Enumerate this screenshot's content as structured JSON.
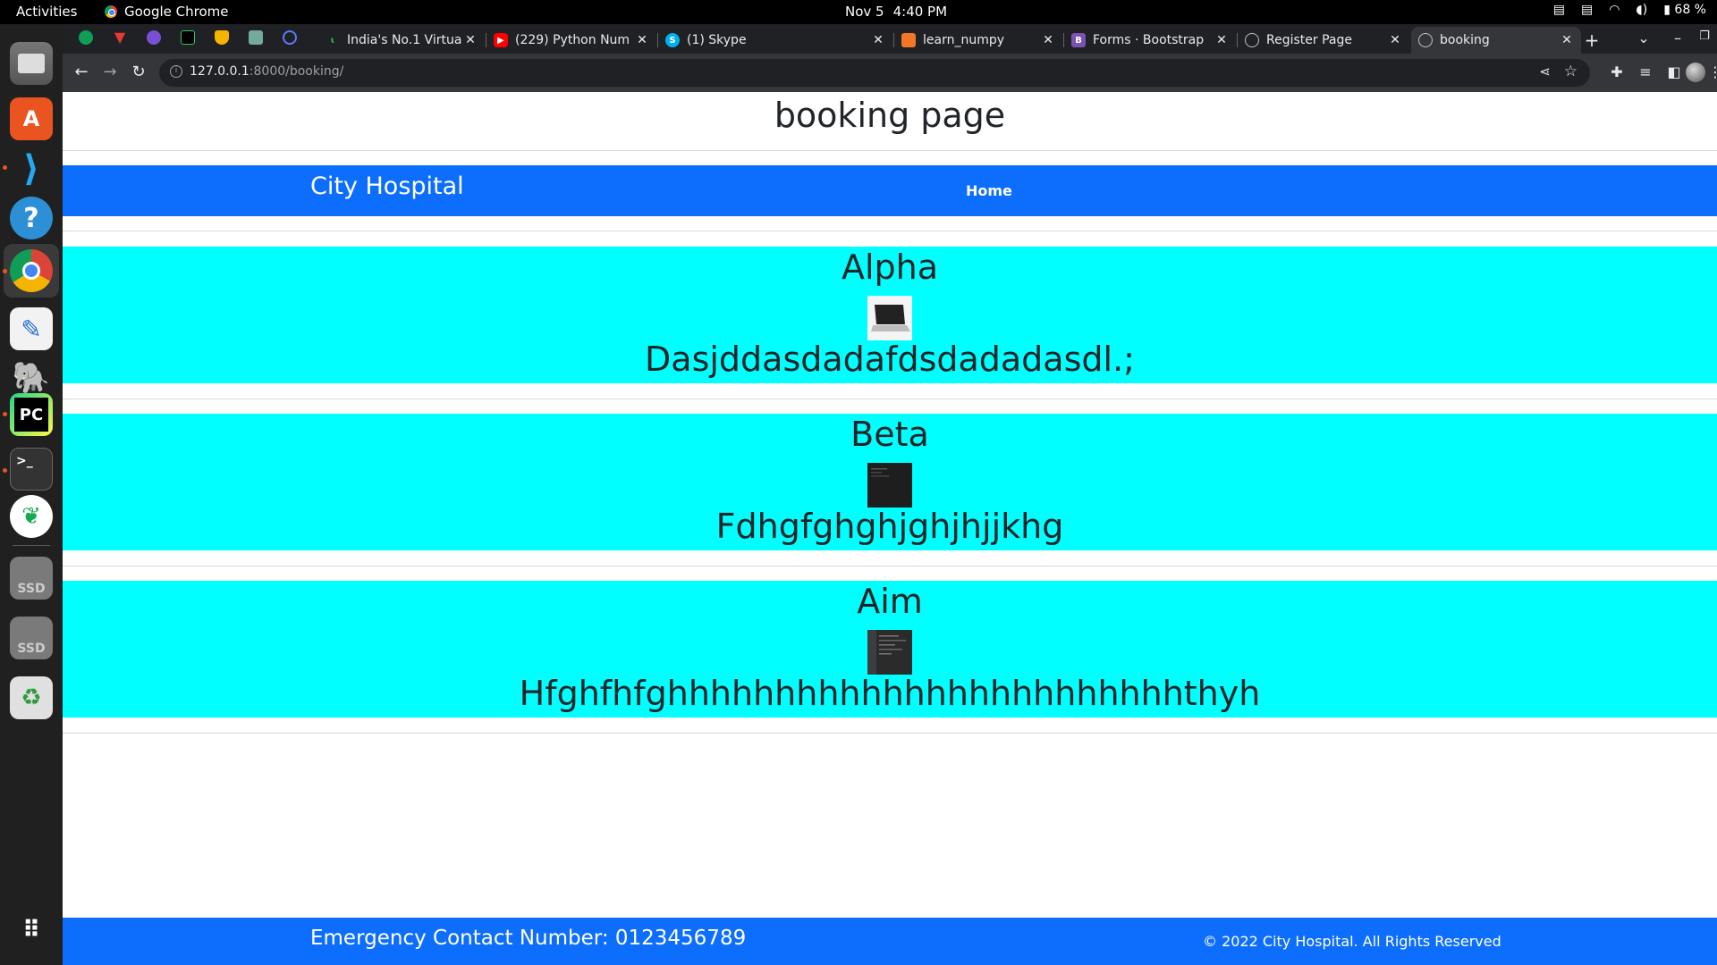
{
  "system": {
    "activities": "Activities",
    "app_name": "Google Chrome",
    "date": "Nov 5",
    "time": "4:40 PM",
    "battery": "68 %"
  },
  "tabs": [
    {
      "title": "India's No.1 Virtua",
      "favicon": "online-course-icon"
    },
    {
      "title": "(229) Python Num",
      "favicon": "youtube-icon"
    },
    {
      "title": "(1) Skype",
      "favicon": "skype-icon"
    },
    {
      "title": "learn_numpy",
      "favicon": "notebook-icon"
    },
    {
      "title": "Forms · Bootstrap",
      "favicon": "bootstrap-icon"
    },
    {
      "title": "Register Page",
      "favicon": "globe-icon"
    },
    {
      "title": "booking",
      "favicon": "globe-icon",
      "active": true
    }
  ],
  "address_bar": {
    "host": "127.0.0.1",
    "rest": ":8000/booking/"
  },
  "page": {
    "heading": "booking page",
    "navbar": {
      "brand": "City Hospital",
      "home": "Home"
    },
    "items": [
      {
        "name": "Alpha",
        "image": "laptop-image",
        "description": "Dasjddasdadafdsdadadasdl.;"
      },
      {
        "name": "Beta",
        "image": "dark-screenshot-image",
        "description": "Fdhgfghghjghjhjjkhg"
      },
      {
        "name": "Aim",
        "image": "code-screenshot-image",
        "description": "Hfghfhfghhhhhhhhhhhhhhhhhhhhhhhhthyh"
      }
    ],
    "footer": {
      "emergency": "Emergency Contact Number: 0123456789",
      "copyright": "© 2022 City Hospital. All Rights Reserved"
    }
  },
  "colors": {
    "navbar": "#0d6efd",
    "card": "#00ffff"
  }
}
